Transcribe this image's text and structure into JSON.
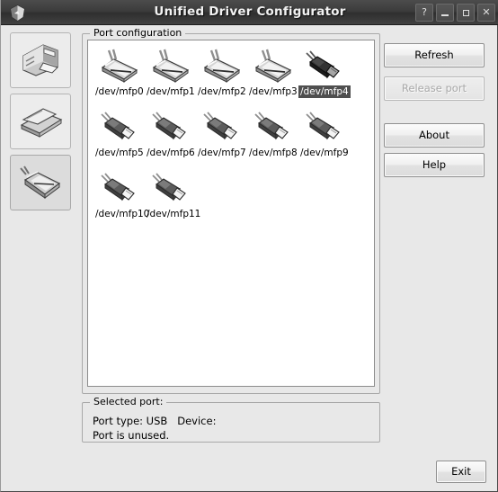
{
  "window": {
    "title": "Unified Driver Configurator",
    "app_icon": "app-shield-icon",
    "controls": {
      "help": "?",
      "minimize": "_",
      "maximize": "□",
      "close": "✕"
    }
  },
  "sidebar": {
    "items": [
      {
        "name": "printers-configuration-tab",
        "icon": "printer-icon",
        "selected": false
      },
      {
        "name": "scanners-configuration-tab",
        "icon": "scanner-icon",
        "selected": false
      },
      {
        "name": "ports-configuration-tab",
        "icon": "port-icon",
        "selected": true
      }
    ]
  },
  "main": {
    "group_title": "Port configuration",
    "ports": [
      {
        "label": "/dev/mfp0",
        "type": "parallel",
        "selected": false
      },
      {
        "label": "/dev/mfp1",
        "type": "parallel",
        "selected": false
      },
      {
        "label": "/dev/mfp2",
        "type": "parallel",
        "selected": false
      },
      {
        "label": "/dev/mfp3",
        "type": "parallel",
        "selected": false
      },
      {
        "label": "/dev/mfp4",
        "type": "usb",
        "selected": true
      },
      {
        "label": "/dev/mfp5",
        "type": "usb",
        "selected": false
      },
      {
        "label": "/dev/mfp6",
        "type": "usb",
        "selected": false
      },
      {
        "label": "/dev/mfp7",
        "type": "usb",
        "selected": false
      },
      {
        "label": "/dev/mfp8",
        "type": "usb",
        "selected": false
      },
      {
        "label": "/dev/mfp9",
        "type": "usb",
        "selected": false
      },
      {
        "label": "/dev/mfp10",
        "type": "usb",
        "selected": false
      },
      {
        "label": "/dev/mfp11",
        "type": "usb",
        "selected": false
      }
    ]
  },
  "actions": {
    "refresh": "Refresh",
    "release_port": "Release port",
    "release_port_disabled": true,
    "about": "About",
    "help": "Help",
    "exit": "Exit"
  },
  "selected_port": {
    "group_title": "Selected port:",
    "line1": "Port type: USB   Device:",
    "line2": "Port is unused."
  },
  "colors": {
    "titlebar": "#3c3c3c",
    "dialog_bg": "#e8e8e8",
    "list_bg": "#ffffff",
    "selection_bg": "#4f4f4f",
    "selection_fg": "#ffffff",
    "disabled_fg": "#a9a9a9"
  }
}
